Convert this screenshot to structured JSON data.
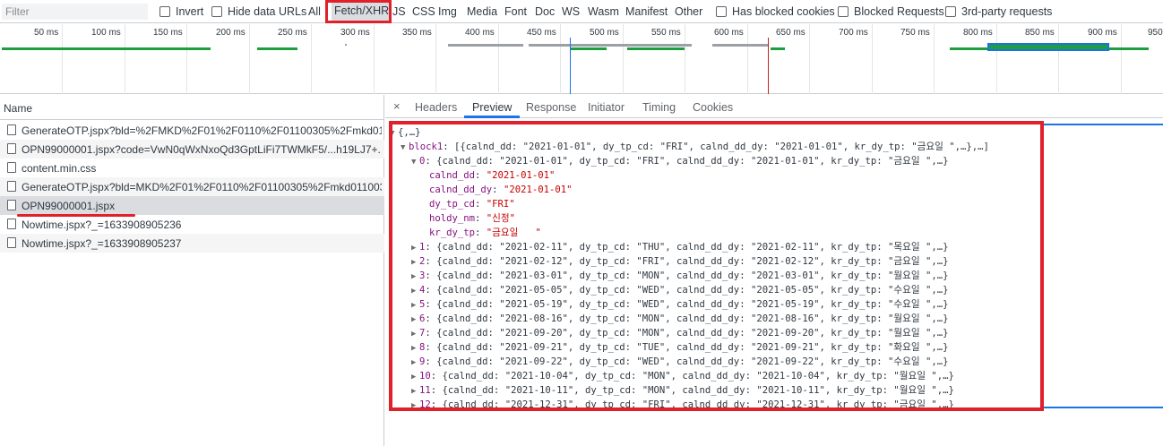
{
  "filter_bar": {
    "filter_placeholder": "Filter",
    "invert_label": "Invert",
    "hide_data_urls_label": "Hide data URLs",
    "types": [
      "All",
      "Fetch/XHR",
      "JS",
      "CSS",
      "Img",
      "Media",
      "Font",
      "Doc",
      "WS",
      "Wasm",
      "Manifest",
      "Other"
    ],
    "selected_type": "Fetch/XHR",
    "has_blocked_cookies_label": "Has blocked cookies",
    "blocked_requests_label": "Blocked Requests",
    "third_party_label": "3rd-party requests"
  },
  "overview": {
    "ticks": [
      "50 ms",
      "100 ms",
      "150 ms",
      "200 ms",
      "250 ms",
      "300 ms",
      "350 ms",
      "400 ms",
      "450 ms",
      "500 ms",
      "550 ms",
      "600 ms",
      "650 ms",
      "700 ms",
      "750 ms",
      "800 ms",
      "850 ms",
      "900 ms",
      "950"
    ],
    "colors": {
      "green": "#1e9e3e",
      "gray": "#9aa0a6",
      "blue": "#1a73e8",
      "red": "#d33"
    }
  },
  "requests": {
    "header": "Name",
    "items": [
      "GenerateOTP.jspx?bld=%2FMKD%2F01%2F0110%2F01100305%2Fmkd01...",
      "OPN99000001.jspx?code=VwN0qWxNxoQd3GptLiFi7TWMkF5/...h19LJ7+...",
      "content.min.css",
      "GenerateOTP.jspx?bld=MKD%2F01%2F0110%2F01100305%2Fmkd011003...",
      "OPN99000001.jspx",
      "Nowtime.jspx?_=1633908905236",
      "Nowtime.jspx?_=1633908905237"
    ]
  },
  "detail": {
    "close_symbol": "×",
    "tabs": [
      "Headers",
      "Preview",
      "Response",
      "Initiator",
      "Timing",
      "Cookies"
    ],
    "active_tab": "Preview",
    "root": "{,…}",
    "block_key": "block1",
    "block_summary": "[{calnd_dd: \"2021-01-01\", dy_tp_cd: \"FRI\", calnd_dd_dy: \"2021-01-01\", kr_dy_tp: \"금요일 \",…},…]",
    "item0_summary": "{calnd_dd: \"2021-01-01\", dy_tp_cd: \"FRI\", calnd_dd_dy: \"2021-01-01\", kr_dy_tp: \"금요일 \",…}",
    "item0_fields": [
      {
        "key": "calnd_dd",
        "value": "\"2021-01-01\""
      },
      {
        "key": "calnd_dd_dy",
        "value": "\"2021-01-01\""
      },
      {
        "key": "dy_tp_cd",
        "value": "\"FRI\""
      },
      {
        "key": "holdy_nm",
        "value": "\"신정\""
      },
      {
        "key": "kr_dy_tp",
        "value": "\"금요일   \""
      }
    ],
    "items": [
      {
        "idx": "1",
        "summary": "{calnd_dd: \"2021-02-11\", dy_tp_cd: \"THU\", calnd_dd_dy: \"2021-02-11\", kr_dy_tp: \"목요일 \",…}"
      },
      {
        "idx": "2",
        "summary": "{calnd_dd: \"2021-02-12\", dy_tp_cd: \"FRI\", calnd_dd_dy: \"2021-02-12\", kr_dy_tp: \"금요일 \",…}"
      },
      {
        "idx": "3",
        "summary": "{calnd_dd: \"2021-03-01\", dy_tp_cd: \"MON\", calnd_dd_dy: \"2021-03-01\", kr_dy_tp: \"월요일 \",…}"
      },
      {
        "idx": "4",
        "summary": "{calnd_dd: \"2021-05-05\", dy_tp_cd: \"WED\", calnd_dd_dy: \"2021-05-05\", kr_dy_tp: \"수요일 \",…}"
      },
      {
        "idx": "5",
        "summary": "{calnd_dd: \"2021-05-19\", dy_tp_cd: \"WED\", calnd_dd_dy: \"2021-05-19\", kr_dy_tp: \"수요일 \",…}"
      },
      {
        "idx": "6",
        "summary": "{calnd_dd: \"2021-08-16\", dy_tp_cd: \"MON\", calnd_dd_dy: \"2021-08-16\", kr_dy_tp: \"월요일 \",…}"
      },
      {
        "idx": "7",
        "summary": "{calnd_dd: \"2021-09-20\", dy_tp_cd: \"MON\", calnd_dd_dy: \"2021-09-20\", kr_dy_tp: \"월요일 \",…}"
      },
      {
        "idx": "8",
        "summary": "{calnd_dd: \"2021-09-21\", dy_tp_cd: \"TUE\", calnd_dd_dy: \"2021-09-21\", kr_dy_tp: \"화요일 \",…}"
      },
      {
        "idx": "9",
        "summary": "{calnd_dd: \"2021-09-22\", dy_tp_cd: \"WED\", calnd_dd_dy: \"2021-09-22\", kr_dy_tp: \"수요일 \",…}"
      },
      {
        "idx": "10",
        "summary": "{calnd_dd: \"2021-10-04\", dy_tp_cd: \"MON\", calnd_dd_dy: \"2021-10-04\", kr_dy_tp: \"월요일 \",…}"
      },
      {
        "idx": "11",
        "summary": "{calnd_dd: \"2021-10-11\", dy_tp_cd: \"MON\", calnd_dd_dy: \"2021-10-11\", kr_dy_tp: \"월요일 \",…}"
      },
      {
        "idx": "12",
        "summary": "{calnd_dd: \"2021-12-31\", dy_tp_cd: \"FRI\", calnd_dd_dy: \"2021-12-31\", kr_dy_tp: \"금요일 \",…}"
      }
    ]
  }
}
